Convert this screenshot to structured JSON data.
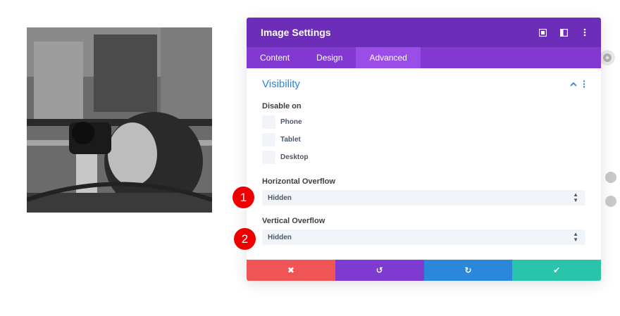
{
  "modal": {
    "title": "Image Settings",
    "tabs": [
      {
        "label": "Content"
      },
      {
        "label": "Design"
      },
      {
        "label": "Advanced"
      }
    ]
  },
  "section": {
    "title": "Visibility"
  },
  "disable_on": {
    "label": "Disable on",
    "options": [
      {
        "label": "Phone"
      },
      {
        "label": "Tablet"
      },
      {
        "label": "Desktop"
      }
    ]
  },
  "horizontal_overflow": {
    "label": "Horizontal Overflow",
    "value": "Hidden"
  },
  "vertical_overflow": {
    "label": "Vertical Overflow",
    "value": "Hidden"
  },
  "badges": {
    "one": "1",
    "two": "2"
  },
  "footer": {
    "cancel_icon": "✖",
    "undo_icon": "↺",
    "redo_icon": "↻",
    "save_icon": "✔"
  },
  "colors": {
    "header": "#6c2eb9",
    "tabs": "#8139d1",
    "active_tab": "#9b4de8",
    "section_title": "#2b87da",
    "cancel": "#ef5555",
    "undo": "#7d3bcf",
    "redo": "#2b87da",
    "save": "#29c4a9",
    "badge": "#ee0000"
  }
}
